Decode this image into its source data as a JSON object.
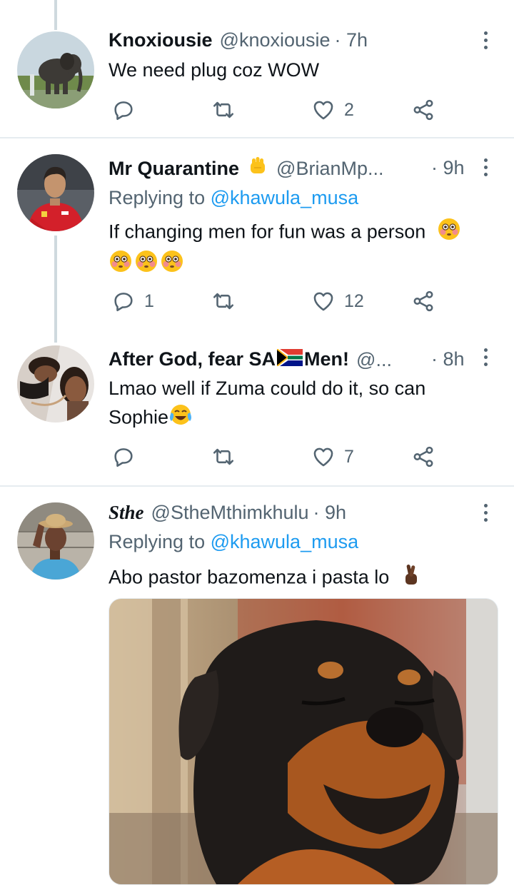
{
  "tweets": [
    {
      "name": "Knoxiousie",
      "handle": "@knoxiousie",
      "time": "· 7h",
      "replying_prefix": "",
      "replying_mention": "",
      "text_lines": [
        "We need plug coz WOW"
      ],
      "counts": {
        "reply": "",
        "retweet": "",
        "like": "2"
      }
    },
    {
      "name": "Mr Quarantine",
      "handle": "@BrianMp...",
      "time": "· 9h",
      "replying_prefix": "Replying to ",
      "replying_mention": "@khawula_musa",
      "text_lines": [
        "If changing men for fun was a person"
      ],
      "counts": {
        "reply": "1",
        "retweet": "",
        "like": "12"
      }
    },
    {
      "name_part1": "After God, fear SA",
      "name_part2": "Men!",
      "handle": "@...",
      "time": "· 8h",
      "text_lines": [
        "Lmao well if Zuma could do it, so can",
        "Sophie"
      ],
      "counts": {
        "reply": "",
        "retweet": "",
        "like": "7"
      }
    },
    {
      "name": "Sthe",
      "handle": "@StheMthimkhulu",
      "time": "· 9h",
      "replying_prefix": "Replying to ",
      "replying_mention": "@khawula_musa",
      "text_lines": [
        "Abo pastor bazomenza i pasta lo"
      ]
    }
  ],
  "icons": {
    "reply": "reply-icon",
    "retweet": "retweet-icon",
    "like": "heart-icon",
    "share": "share-icon",
    "more": "more-vertical-icon"
  },
  "colors": {
    "accent": "#1d9bf0",
    "secondary_text": "#536471",
    "divider": "#e6ecf0"
  }
}
